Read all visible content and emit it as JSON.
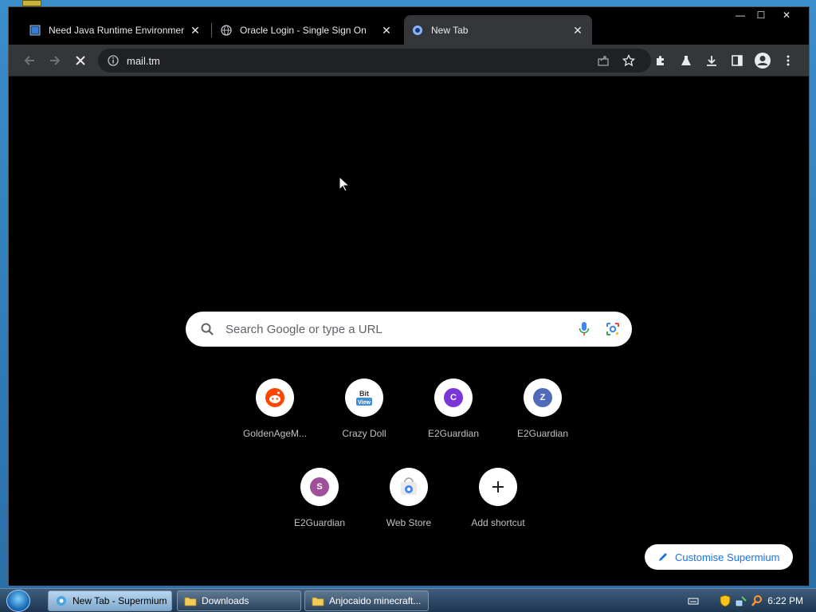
{
  "browser": {
    "tabs": [
      {
        "title": "Need Java Runtime Environment (",
        "close": "✕"
      },
      {
        "title": "Oracle Login - Single Sign On",
        "close": "✕"
      },
      {
        "title": "New Tab",
        "close": "✕"
      }
    ],
    "window_controls": {
      "minimize": "—",
      "maximize": "☐",
      "close": "✕"
    },
    "address": {
      "url": "mail.tm",
      "site_info_icon": "info-icon"
    },
    "toolbar_icons": [
      "back-icon",
      "forward-icon",
      "stop-icon",
      "share-icon",
      "bookmark-star-icon",
      "extensions-icon",
      "labs-icon",
      "download-icon",
      "side-panel-icon",
      "profile-icon",
      "menu-icon"
    ]
  },
  "ntp": {
    "search_placeholder": "Search Google or type a URL",
    "shortcuts": [
      {
        "label": "GoldenAgeM...",
        "icon": "reddit-icon"
      },
      {
        "label": "Crazy Doll",
        "icon": "bitview-icon"
      },
      {
        "label": "E2Guardian",
        "icon": "letter-c-icon",
        "letter": "C",
        "color": "#7b35d8"
      },
      {
        "label": "E2Guardian",
        "icon": "letter-z-icon",
        "letter": "Z",
        "color": "#4f6ab8"
      },
      {
        "label": "E2Guardian",
        "icon": "letter-s-icon",
        "letter": "S",
        "color": "#a0509a"
      },
      {
        "label": "Web Store",
        "icon": "webstore-icon"
      },
      {
        "label": "Add shortcut",
        "icon": "plus-icon"
      }
    ],
    "customise_label": "Customise Supermium"
  },
  "taskbar": {
    "buttons": [
      {
        "label": "New Tab - Supermium",
        "icon": "browser-icon"
      },
      {
        "label": "Downloads",
        "icon": "folder-icon"
      },
      {
        "label": "Anjocaido minecraft...",
        "icon": "folder-icon"
      }
    ],
    "clock": "6:22 PM"
  },
  "colors": {
    "tab_active_bg": "#35363a",
    "toolbar_bg": "#35363a",
    "page_bg": "#000000",
    "accent": "#1a73e8"
  }
}
